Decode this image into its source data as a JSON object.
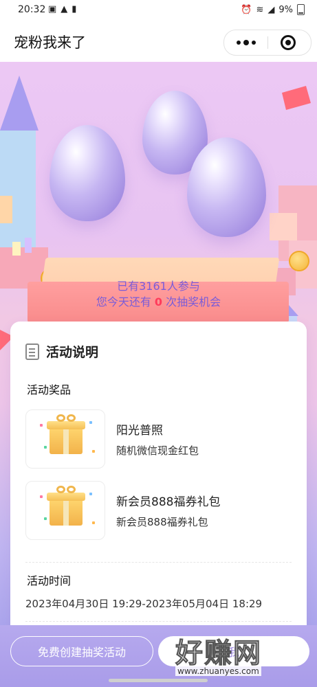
{
  "status_bar": {
    "time": "20:32",
    "battery": "9%",
    "network": "4G"
  },
  "nav": {
    "title": "宠粉我来了"
  },
  "hero": {
    "participants_text": "已有3161人参与",
    "chances_prefix": "您今天还有",
    "chances_count": "0",
    "chances_suffix": "次抽奖机会"
  },
  "card": {
    "title": "活动说明",
    "prizes_label": "活动奖品",
    "prizes": [
      {
        "name": "阳光普照",
        "desc": "随机微信现金红包"
      },
      {
        "name": "新会员888福券礼包",
        "desc": "新会员888福券礼包"
      }
    ],
    "time_label": "活动时间",
    "time_range": "2023年04月30日 19:29-2023年05月04日 18:29"
  },
  "bottom": {
    "create_label": "免费创建抽奖活动",
    "my_label": "我"
  },
  "watermark": {
    "cn": "好赚网",
    "url": "www.zhuanyes.com"
  },
  "colors": {
    "accent_purple": "#7a5cd8",
    "highlight_red": "#ff3b5b",
    "bottom_bar": "#ab9eea"
  }
}
